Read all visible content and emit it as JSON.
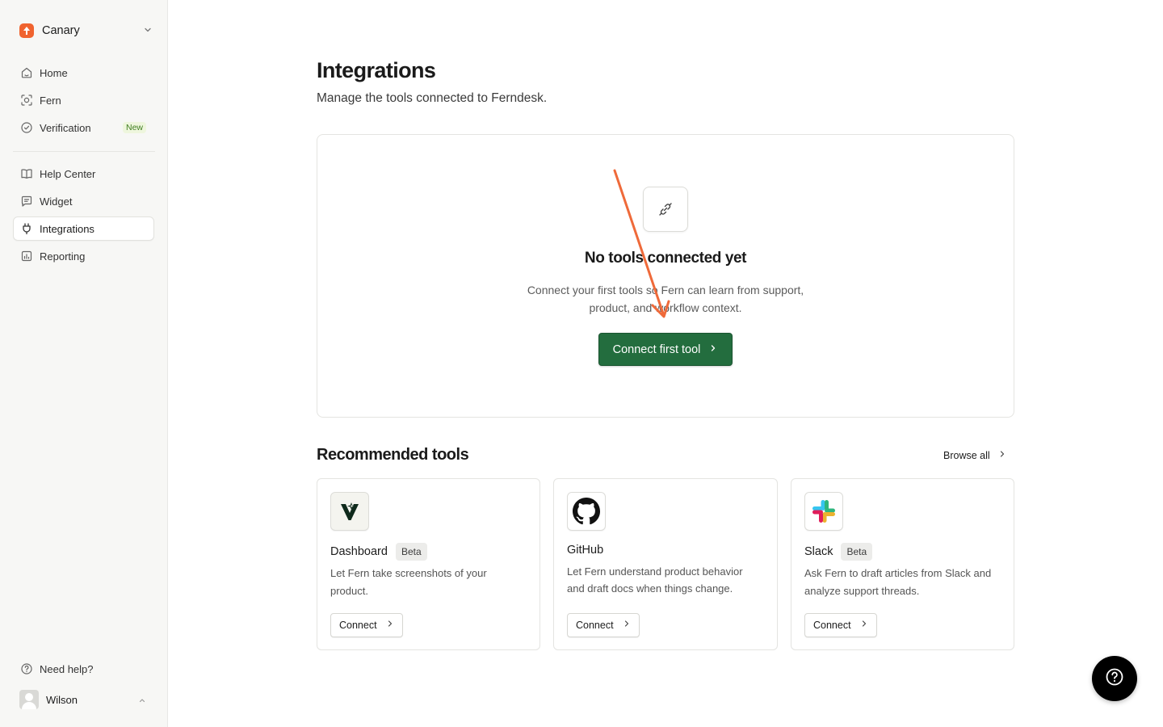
{
  "workspace": {
    "name": "Canary",
    "logo_color": "#f0632f"
  },
  "sidebar": {
    "primary_items": [
      {
        "label": "Home",
        "icon": "home-icon"
      },
      {
        "label": "Fern",
        "icon": "scan-face-icon"
      },
      {
        "label": "Verification",
        "icon": "check-circle-icon",
        "badge": "New"
      }
    ],
    "secondary_items": [
      {
        "label": "Help Center",
        "icon": "book-icon"
      },
      {
        "label": "Widget",
        "icon": "message-square-icon"
      },
      {
        "label": "Integrations",
        "icon": "plug-icon",
        "active": true
      },
      {
        "label": "Reporting",
        "icon": "report-icon"
      }
    ],
    "help": {
      "label": "Need help?",
      "icon": "help-circle-icon"
    },
    "user": {
      "name": "Wilson"
    }
  },
  "page": {
    "title": "Integrations",
    "subtitle": "Manage the tools connected to Ferndesk."
  },
  "empty_state": {
    "icon": "link-icon",
    "title": "No tools connected yet",
    "description": "Connect your first tools so Fern can learn from support, product, and workflow context.",
    "button_label": "Connect first tool",
    "button_color": "#236d3e",
    "annotation_arrow_color": "#ef6a3a"
  },
  "recommended": {
    "title": "Recommended tools",
    "browse_all_label": "Browse all",
    "tools": [
      {
        "name": "Dashboard",
        "badge": "Beta",
        "description": "Let Fern take screenshots of your product.",
        "connect_label": "Connect",
        "logo": "dashboard-logo-icon"
      },
      {
        "name": "GitHub",
        "description": "Let Fern understand product behavior and draft docs when things change.",
        "connect_label": "Connect",
        "logo": "github-logo-icon"
      },
      {
        "name": "Slack",
        "badge": "Beta",
        "description": "Ask Fern to draft articles from Slack and analyze support threads.",
        "connect_label": "Connect",
        "logo": "slack-logo-icon"
      }
    ]
  },
  "help_button": {
    "icon": "help-circle-icon"
  }
}
